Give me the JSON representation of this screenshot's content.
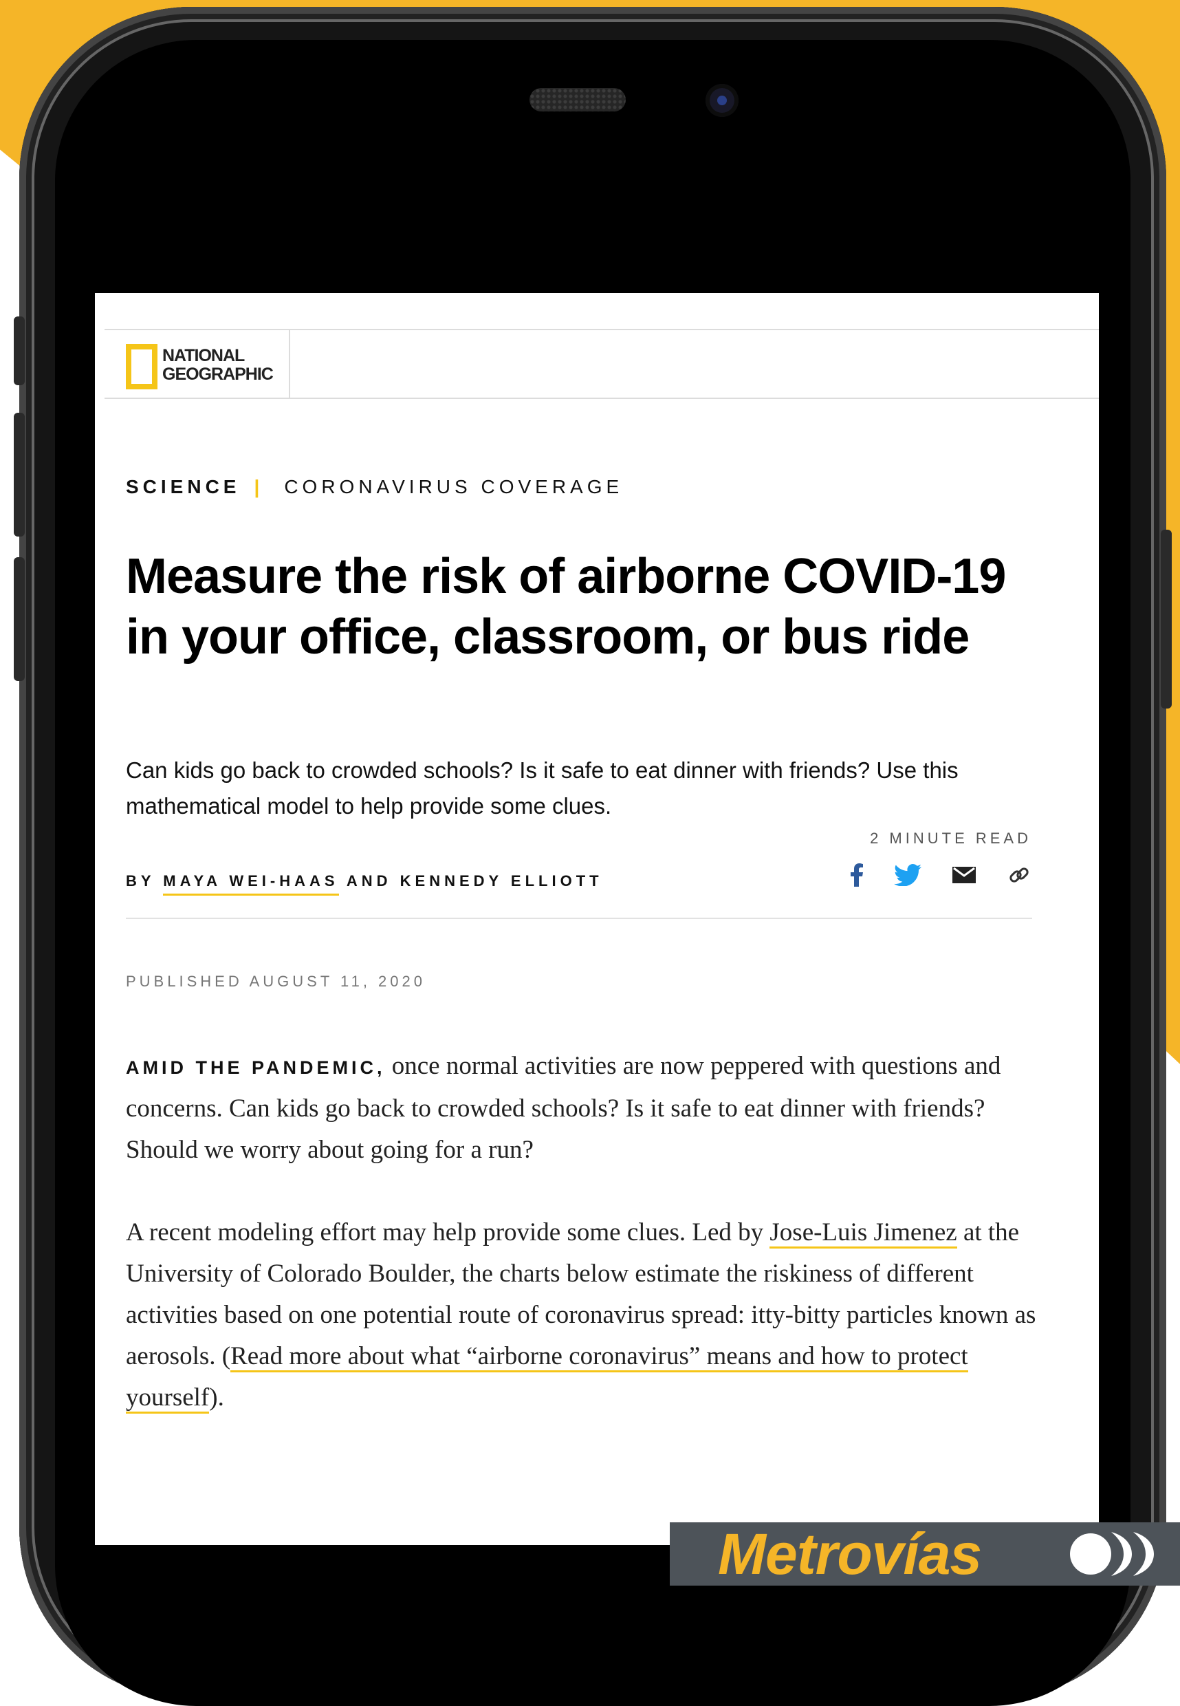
{
  "brand": {
    "logo_lines": "NATIONAL\nGEOGRAPHIC",
    "accent_color": "#f5c518"
  },
  "article": {
    "section": "SCIENCE",
    "separator": "|",
    "category": "CORONAVIRUS COVERAGE",
    "title": "Measure the risk of airborne COVID-19 in your office, classroom, or bus ride",
    "dek": "Can kids go back to crowded schools? Is it safe to eat dinner with friends? Use this mathematical model to help provide some clues.",
    "read_time": "2 MINUTE READ",
    "byline": {
      "prefix": "BY",
      "author1": "MAYA WEI-HAAS",
      "conjunction": "AND",
      "author2": "KENNEDY ELLIOTT"
    },
    "share_icons": [
      "facebook-icon",
      "twitter-icon",
      "email-icon",
      "link-icon"
    ],
    "published": "PUBLISHED AUGUST 11, 2020",
    "p1_lead": "AMID THE PANDEMIC,",
    "p1_text": "once normal activities are now peppered with questions and concerns. Can kids go back to crowded schools? Is it safe to eat dinner with friends? Should we worry about going for a run?",
    "p2_before": "A recent modeling effort may help provide some clues. Led by",
    "p2_link1": "Jose-Luis Jimenez",
    "p2_middle": "at the University of Colorado Boulder, the charts below estimate the riskiness of different activities based on one potential route of coronavirus spread: itty-bitty particles known as aerosols.",
    "p2_paren_open": "(",
    "p2_link2": "Read more about what “airborne coronavirus” means and how to protect yourself",
    "p2_paren_close": ")."
  },
  "sponsor": {
    "name": "Metrovías",
    "bar_color": "#4d5359",
    "text_color": "#f5b528"
  }
}
